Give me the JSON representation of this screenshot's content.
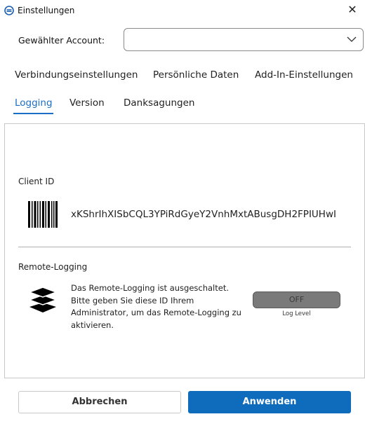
{
  "window": {
    "title": "Einstellungen"
  },
  "account": {
    "label": "Gewählter Account:",
    "selected_value": ""
  },
  "tabs": [
    {
      "label": "Verbindungseinstellungen"
    },
    {
      "label": "Persönliche Daten"
    },
    {
      "label": "Add-In-Einstellungen"
    },
    {
      "label": "Logging"
    },
    {
      "label": "Version"
    },
    {
      "label": "Danksagungen"
    }
  ],
  "active_tab": "Logging",
  "logging": {
    "client_id_label": "Client ID",
    "client_id_value": "xKShrIhXISbCQL3YPiRdGyeY2VnhMxtABusgDH2FPIUHwI",
    "remote_logging_label": "Remote-Logging",
    "remote_logging_text": "Das Remote-Logging ist ausgeschaltet. Bitte geben Sie diese ID Ihrem Administrator, um das Remote-Logging zu aktivieren.",
    "toggle_label": "OFF",
    "toggle_caption": "Log Level"
  },
  "buttons": {
    "cancel": "Abbrechen",
    "apply": "Anwenden"
  },
  "colors": {
    "accent": "#0f6cbd",
    "active_tab": "#1a6fc4"
  }
}
